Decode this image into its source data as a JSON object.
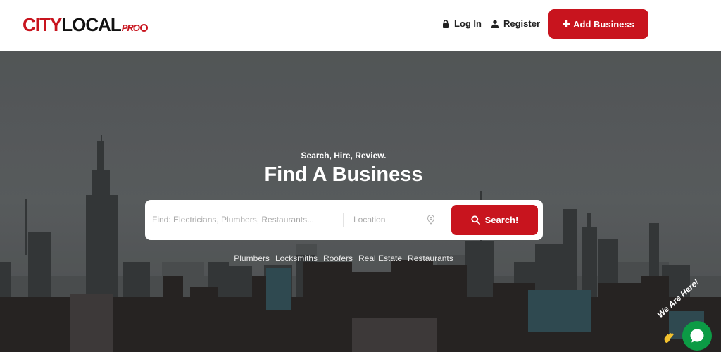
{
  "brand": {
    "city": "CITY",
    "local": "LOCAL",
    "pro": "PRO",
    "accent_color": "#c8141e"
  },
  "nav": {
    "login_label": "Log In",
    "register_label": "Register",
    "add_business_label": "Add Business"
  },
  "hero": {
    "tagline": "Search, Hire, Review.",
    "title": "Find A Business"
  },
  "search": {
    "find_placeholder": "Find: Electricians, Plumbers, Restaurants...",
    "find_value": "",
    "location_placeholder": "Location",
    "location_value": "",
    "button_label": "Search!"
  },
  "quick_links": [
    "Plumbers",
    "Locksmiths",
    "Roofers",
    "Real Estate",
    "Restaurants"
  ],
  "chat": {
    "label": "We Are Here!",
    "color": "#0c9b45"
  },
  "icons": {
    "login": "lock-icon",
    "register": "user-icon",
    "add": "plus-icon",
    "location": "map-pin-icon",
    "search": "search-icon",
    "chat": "chat-icon"
  }
}
